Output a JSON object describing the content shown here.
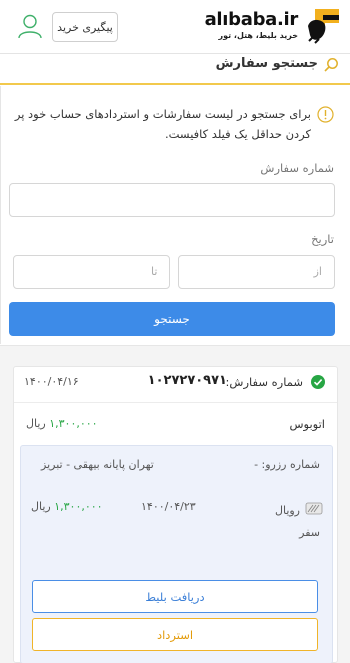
{
  "header": {
    "logo_text": "alıbaba.ir",
    "logo_tagline": "خرید بلیط، هتل، تور",
    "track_button": "پیگیری خرید",
    "logo_color": "#f2b01e"
  },
  "search": {
    "title": "جستجو سفارش",
    "info": "برای جستجو در لیست سفارشات و استردادهای حساب خود پر کردن حداقل یک فیلد کافیست.",
    "order_number_label": "شماره سفارش",
    "date_label": "تاریخ",
    "from_placeholder": "از",
    "to_placeholder": "تا",
    "submit_label": "جستجو"
  },
  "order": {
    "number_label": "شماره سفارش:",
    "number": "۱۰۲۷۲۷۰۹۷۱",
    "date": "۱۴۰۰/۰۴/۱۶",
    "type": "اتوبوس",
    "price": "۱,۳۰۰,۰۰۰",
    "currency": "ریال",
    "reservation_label": "شماره رزرو: -",
    "route": "تهران پایانه بیهقی - تبریز",
    "company": "رویال",
    "company_line2": "سفر",
    "travel_date": "۱۴۰۰/۰۴/۲۳",
    "item_price": "۱,۳۰۰,۰۰۰",
    "item_currency": "ریال",
    "ticket_button": "دریافت بلیط",
    "refund_button": "استرداد"
  },
  "colors": {
    "primary": "#3d8be8",
    "accent_yellow": "#f2c94c",
    "success_green": "#27a644",
    "refund_orange": "#e39b0a"
  }
}
